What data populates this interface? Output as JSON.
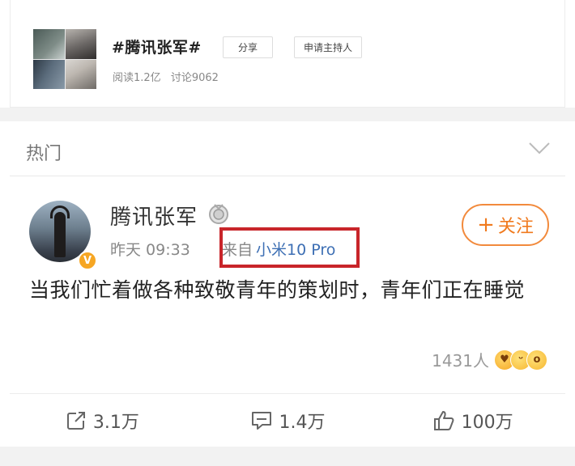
{
  "topic": {
    "title": "#腾讯张军#",
    "reads": "阅读1.2亿",
    "discussions": "讨论9062",
    "share_label": "分享",
    "apply_host_label": "申请主持人"
  },
  "hot_section": {
    "label": "热门"
  },
  "post": {
    "username": "腾讯张军",
    "time": "昨天 09:33",
    "source_prefix": "来自",
    "source_device": "小米10 Pro",
    "follow_label": "关注",
    "follow_plus": "+",
    "text": "当我们忙着做各种致敬青年的策划时，青年们正在睡觉",
    "reaction_count": "1431人",
    "verified_badge": "V"
  },
  "actions": {
    "repost_count": "3.1万",
    "comment_count": "1.4万",
    "like_count": "100万"
  },
  "colors": {
    "link_blue": "#3d6fb4",
    "follow_orange": "#f07a1e",
    "highlight_red": "#c8252a",
    "verified_gold": "#f6a623"
  },
  "icons": [
    "chevron-down-icon",
    "medal-icon",
    "verified-badge-icon",
    "repost-icon",
    "comment-icon",
    "like-icon"
  ]
}
